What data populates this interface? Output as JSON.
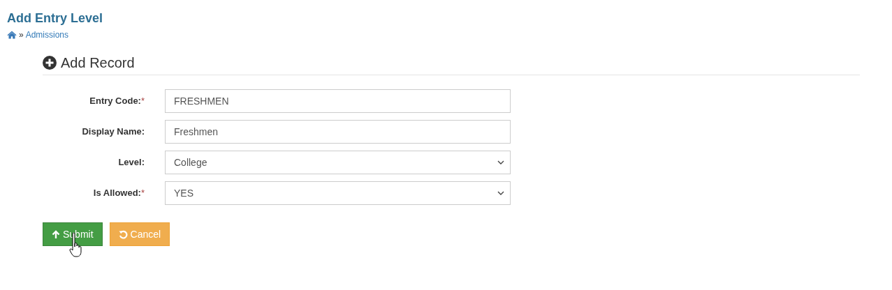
{
  "page_title": "Add Entry Level",
  "breadcrumb": {
    "separator": "»",
    "items": [
      {
        "label": "Admissions"
      }
    ]
  },
  "section_title": "Add Record",
  "fields": [
    {
      "label": "Entry Code:",
      "required_mark": "*",
      "kind": "text",
      "value": "FRESHMEN"
    },
    {
      "label": "Display Name:",
      "kind": "text",
      "value": "Freshmen"
    },
    {
      "label": "Level:",
      "kind": "select",
      "value": "College"
    },
    {
      "label": "Is Allowed:",
      "required_mark": "*",
      "kind": "select",
      "value": "YES"
    }
  ],
  "buttons": [
    {
      "label": "Submit",
      "kind": "submit"
    },
    {
      "label": "Cancel",
      "kind": "cancel"
    }
  ]
}
